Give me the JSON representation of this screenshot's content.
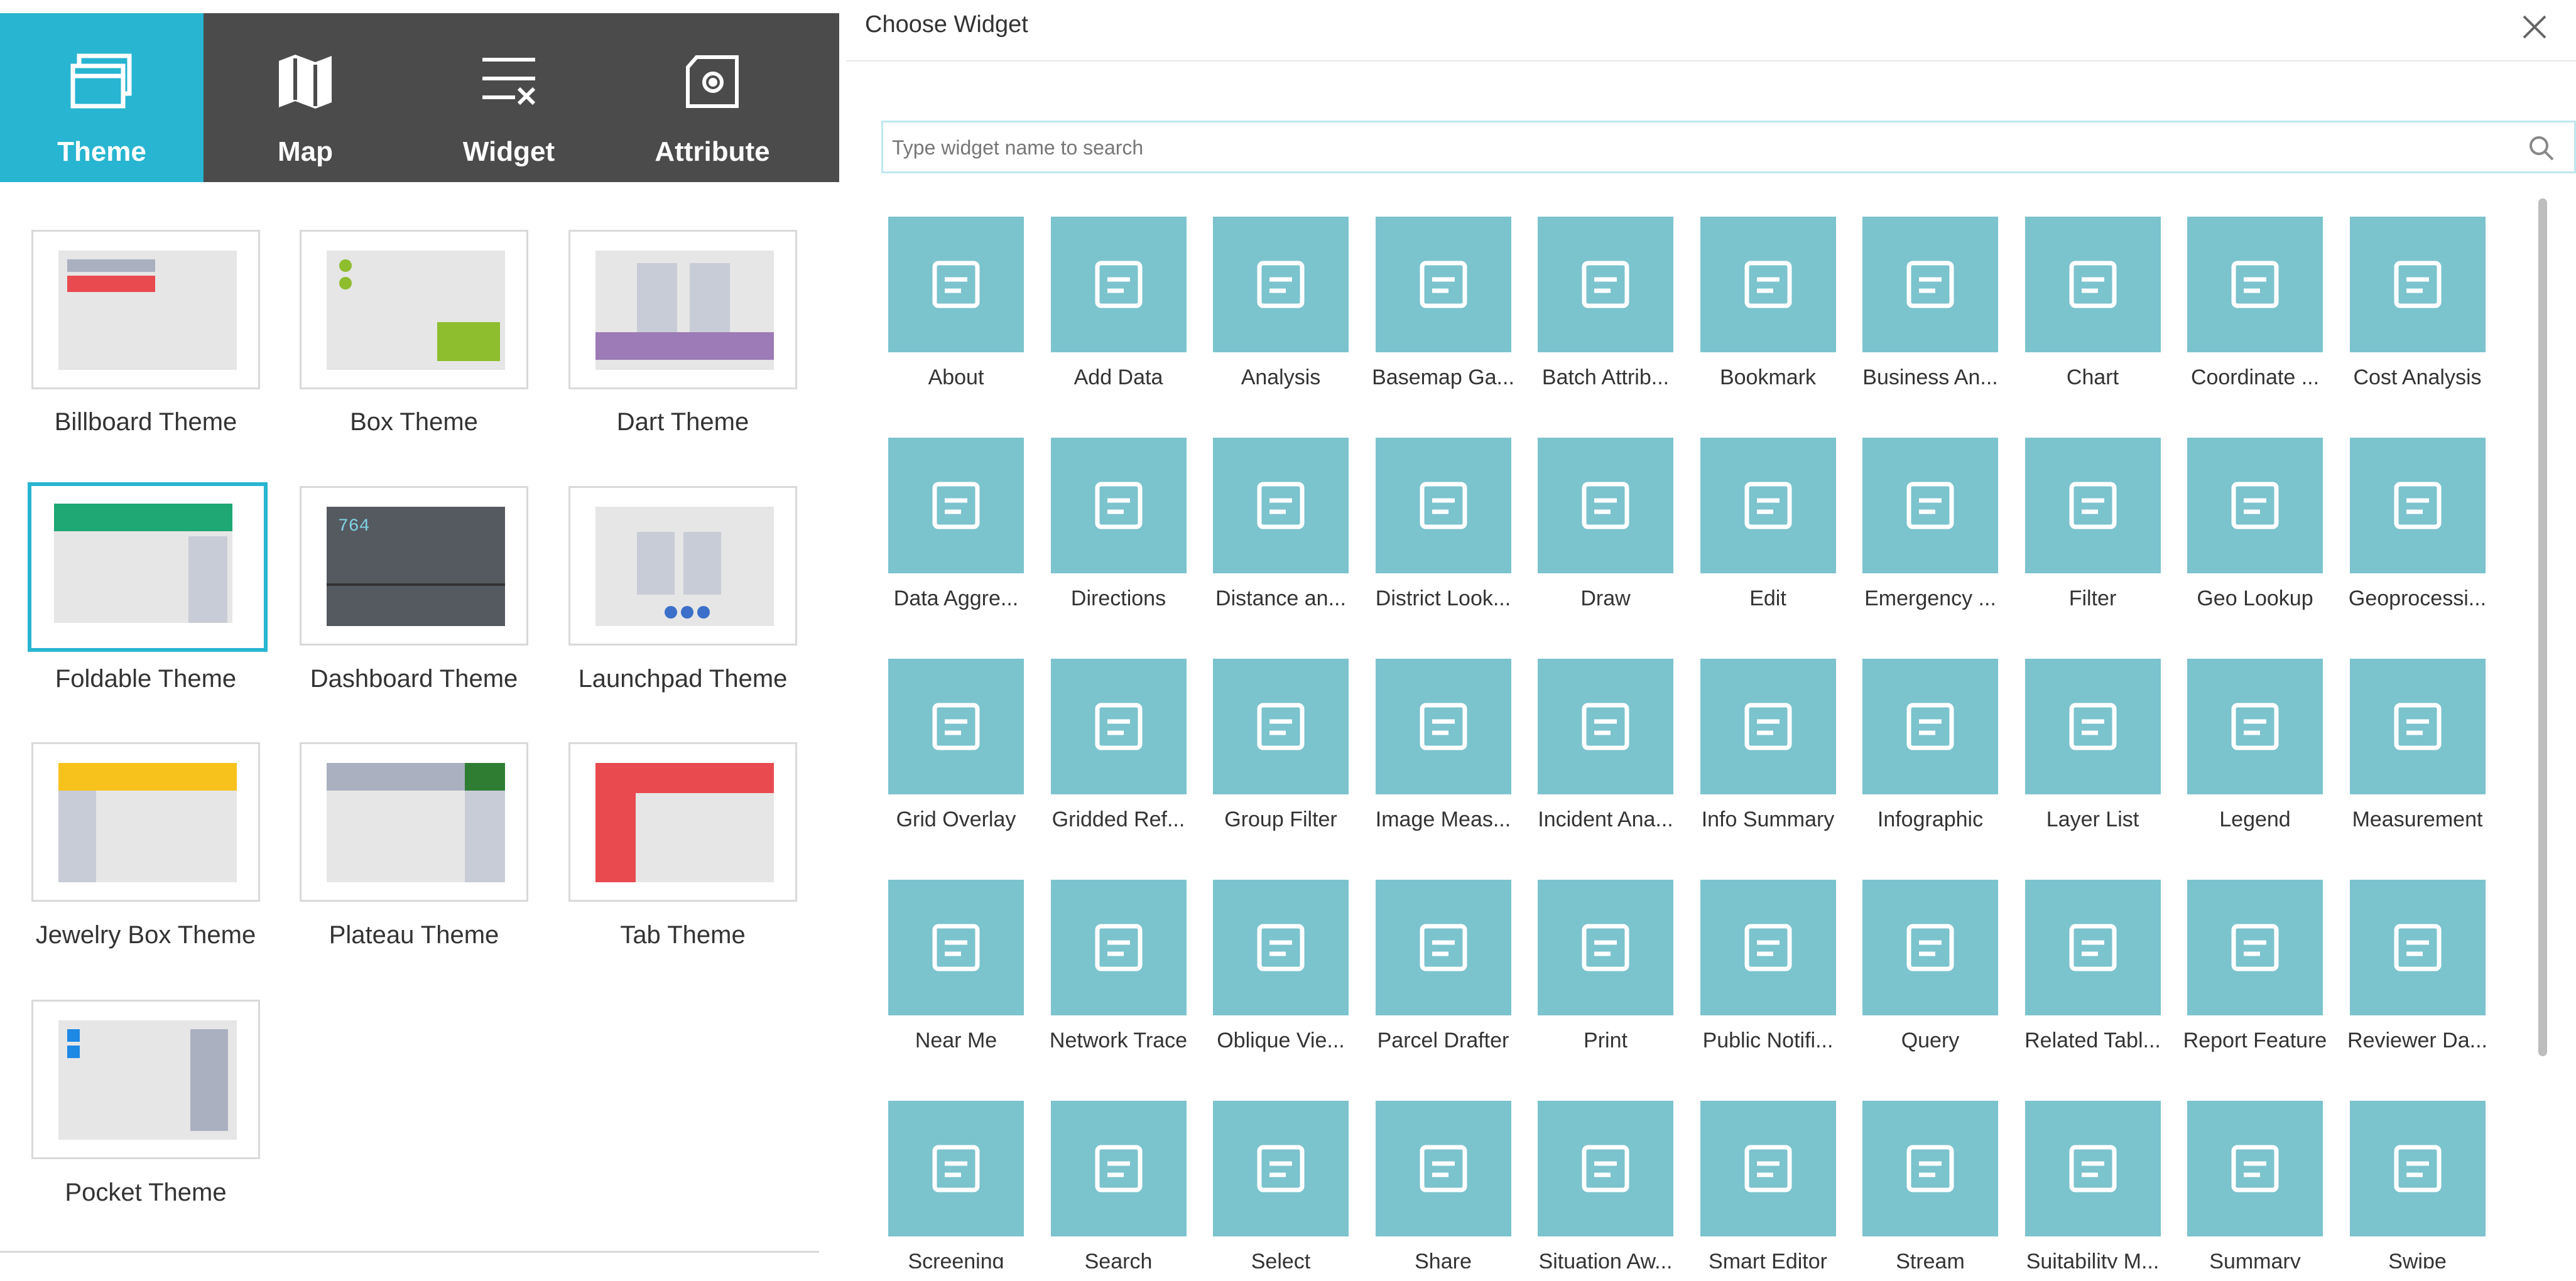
{
  "left_tabs": [
    {
      "label": "Theme",
      "icon": "theme-icon",
      "active": true
    },
    {
      "label": "Map",
      "icon": "map-icon",
      "active": false
    },
    {
      "label": "Widget",
      "icon": "widget-icon",
      "active": false
    },
    {
      "label": "Attribute",
      "icon": "attribute-icon",
      "active": false
    }
  ],
  "themes": [
    {
      "name": "Billboard Theme"
    },
    {
      "name": "Box Theme"
    },
    {
      "name": "Dart Theme"
    },
    {
      "name": "Foldable Theme",
      "selected": true
    },
    {
      "name": "Dashboard Theme"
    },
    {
      "name": "Launchpad Theme"
    },
    {
      "name": "Jewelry Box Theme"
    },
    {
      "name": "Plateau Theme"
    },
    {
      "name": "Tab Theme"
    },
    {
      "name": "Pocket Theme"
    }
  ],
  "dialog": {
    "title": "Choose Widget",
    "search_placeholder": "Type widget name to search"
  },
  "widgets": [
    "About",
    "Add Data",
    "Analysis",
    "Basemap Ga...",
    "Batch Attrib...",
    "Bookmark",
    "Business An...",
    "Chart",
    "Coordinate ...",
    "Cost Analysis",
    "Data Aggre...",
    "Directions",
    "Distance an...",
    "District Look...",
    "Draw",
    "Edit",
    "Emergency ...",
    "Filter",
    "Geo Lookup",
    "Geoprocessi...",
    "Grid Overlay",
    "Gridded Ref...",
    "Group Filter",
    "Image Meas...",
    "Incident Ana...",
    "Info Summary",
    "Infographic",
    "Layer List",
    "Legend",
    "Measurement",
    "Near Me",
    "Network Trace",
    "Oblique Vie...",
    "Parcel Drafter",
    "Print",
    "Public Notifi...",
    "Query",
    "Related Tabl...",
    "Report Feature",
    "Reviewer Da...",
    "Screening",
    "Search",
    "Select",
    "Share",
    "Situation Aw...",
    "Smart Editor",
    "Stream",
    "Suitability M...",
    "Summary",
    "Swipe"
  ],
  "colors": {
    "accent": "#27b5d1",
    "tab_bar": "#4b4b4b",
    "widget_tile": "#7bc3cd"
  }
}
